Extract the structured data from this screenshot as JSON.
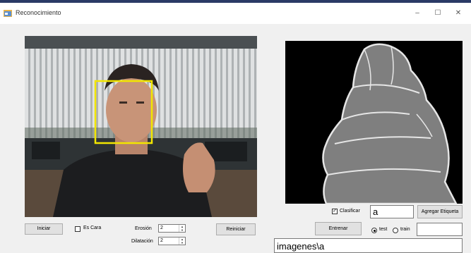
{
  "window": {
    "title": "Reconocimiento",
    "minimize_glyph": "–",
    "maximize_glyph": "☐",
    "close_glyph": "✕"
  },
  "icons": {
    "app": "app-form-icon",
    "minimize": "minimize-icon",
    "maximize": "maximize-icon",
    "close": "close-icon"
  },
  "colors": {
    "face_box": "#f2e600",
    "hand_region": "#7f7f7f",
    "hand_edges": "#e6e6e6"
  },
  "left_controls": {
    "start_label": "Iniciar",
    "is_face_label": "Es Cara",
    "is_face_checked": false,
    "erosion_label": "Erosión",
    "erosion_value": "2",
    "dilation_label": "Dilatación",
    "dilation_value": "2",
    "reset_label": "Reiniciar"
  },
  "right_controls": {
    "classify_label": "Clasificar",
    "classify_checked": true,
    "label_value": "a",
    "add_label_button": "Agregar Etiqueta",
    "train_button": "Entrenar",
    "test_label": "test",
    "train_radio_label": "train",
    "mode_selected": "test",
    "extra_value": "",
    "path_value": "imagenes\\a"
  }
}
